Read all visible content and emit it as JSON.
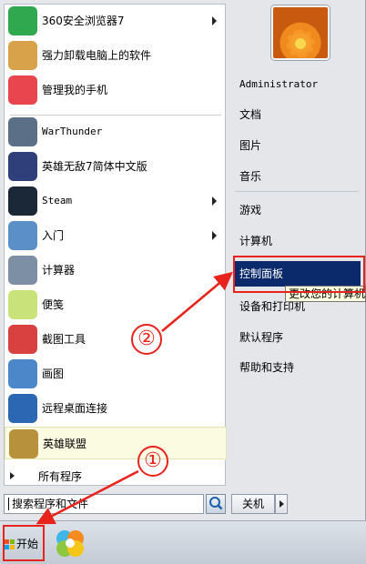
{
  "left_apps": [
    {
      "name": "360-browser",
      "label": "360安全浏览器7",
      "icon": "360-browser-icon",
      "has_arrow": true,
      "mono": false
    },
    {
      "name": "uninstaller",
      "label": "强力卸载电脑上的软件",
      "icon": "trash-recycle-icon",
      "has_arrow": false,
      "mono": false
    },
    {
      "name": "phone-manager",
      "label": "管理我的手机",
      "icon": "phone-manager-icon",
      "has_arrow": false,
      "mono": false
    },
    {
      "name": "warthunder",
      "label": "WarThunder",
      "icon": "warthunder-icon",
      "has_arrow": false,
      "mono": true
    },
    {
      "name": "warcraft3",
      "label": "英雄无敌7简体中文版",
      "icon": "warcraft-icon",
      "has_arrow": false,
      "mono": false
    },
    {
      "name": "steam",
      "label": "Steam",
      "icon": "steam-icon",
      "has_arrow": true,
      "mono": true
    },
    {
      "name": "getting-started",
      "label": "入门",
      "icon": "getting-started-icon",
      "has_arrow": true,
      "mono": false
    },
    {
      "name": "calculator",
      "label": "计算器",
      "icon": "calculator-icon",
      "has_arrow": false,
      "mono": false
    },
    {
      "name": "sticky-notes",
      "label": "便笺",
      "icon": "sticky-notes-icon",
      "has_arrow": false,
      "mono": false
    },
    {
      "name": "snipping-tool",
      "label": "截图工具",
      "icon": "scissors-icon",
      "has_arrow": false,
      "mono": false
    },
    {
      "name": "paint",
      "label": "画图",
      "icon": "paint-palette-icon",
      "has_arrow": false,
      "mono": false
    },
    {
      "name": "remote-desktop",
      "label": "远程桌面连接",
      "icon": "remote-desktop-icon",
      "has_arrow": false,
      "mono": false
    },
    {
      "name": "league-of-legends",
      "label": "英雄联盟",
      "icon": "lol-icon",
      "has_arrow": false,
      "mono": false
    }
  ],
  "all_programs": "所有程序",
  "search": {
    "value": "搜索程序和文件"
  },
  "shutdown": {
    "label": "关机"
  },
  "right_items": [
    {
      "name": "user",
      "label": "Administrator",
      "mono": true
    },
    {
      "name": "documents",
      "label": "文档",
      "mono": false
    },
    {
      "name": "pictures",
      "label": "图片",
      "mono": false
    },
    {
      "name": "music",
      "label": "音乐",
      "mono": false
    },
    {
      "name": "games",
      "label": "游戏",
      "mono": false
    },
    {
      "name": "computer",
      "label": "计算机",
      "mono": false
    },
    {
      "name": "control-panel",
      "label": "控制面板",
      "mono": false
    },
    {
      "name": "devices-printers",
      "label": "设备和打印机",
      "mono": false
    },
    {
      "name": "default-programs",
      "label": "默认程序",
      "mono": false
    },
    {
      "name": "help-support",
      "label": "帮助和支持",
      "mono": false
    }
  ],
  "tooltip": "更改您的计算机",
  "taskbar": {
    "start_label": "开始"
  },
  "annotations": {
    "step1": "①",
    "step2": "②"
  },
  "colors": {
    "accent_selection": "#0a2a6b",
    "annotation_red": "#e8231c",
    "highlight": "#fbfbe2"
  }
}
